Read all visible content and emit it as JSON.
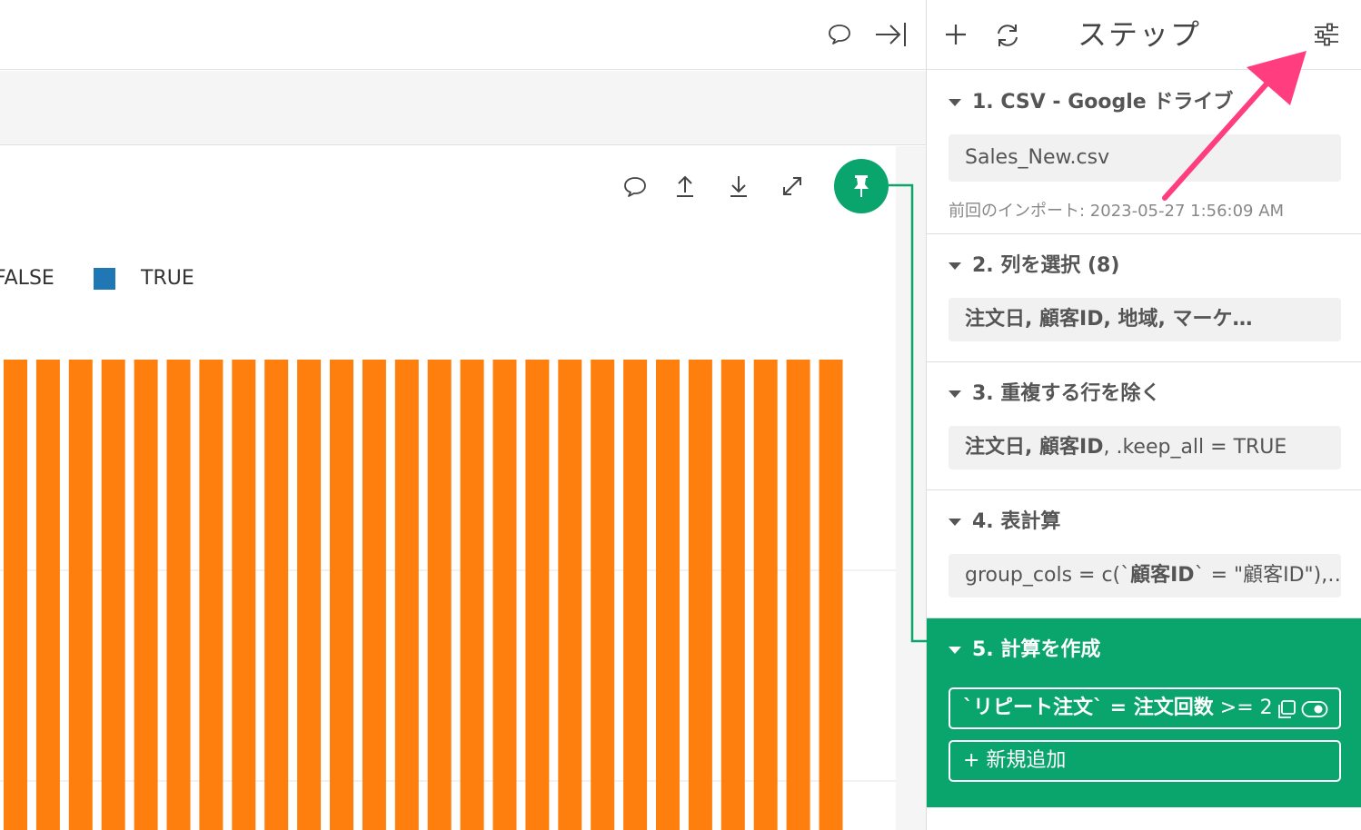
{
  "right_panel": {
    "title": "ステップ",
    "steps": [
      {
        "title": "1. CSV - Google ドライブ",
        "value": "Sales_New.csv",
        "sub": "前回のインポート: 2023-05-27 1:56:09 AM"
      },
      {
        "title": "2. 列を選択 (8)",
        "value": "注文日, 顧客ID, 地域, マーケ…"
      },
      {
        "title": "3. 重複する行を除く",
        "value_bold": "注文日, 顧客ID",
        "value_rest": ", .keep_all = TRUE"
      },
      {
        "title": "4. 表計算",
        "value_pre": "group_cols = c(`",
        "value_bold": "顧客ID",
        "value_post": "` = \"顧客ID\"),…"
      },
      {
        "title": "5. 計算を作成",
        "value_bold": "`リピート注文` = 注文回数",
        "value_rest": " >= 2",
        "add_label": "+ 新規追加"
      }
    ]
  },
  "chart": {
    "legend": [
      {
        "label": "FALSE",
        "color": "#ff7f0e"
      },
      {
        "label": "TRUE",
        "color": "#1f77b4"
      }
    ]
  },
  "chart_data": {
    "type": "bar",
    "series": [
      {
        "name": "FALSE",
        "color": "#ff7f0e"
      },
      {
        "name": "TRUE",
        "color": "#1f77b4"
      }
    ],
    "visible_bar_count": 26
  },
  "colors": {
    "accent_green": "#0aa56d",
    "arrow_pink": "#ff3d7f"
  },
  "icons": [
    "comment-icon",
    "collapse-panel-icon",
    "upload-icon",
    "download-icon",
    "expand-icon",
    "pin-icon",
    "plus-icon",
    "refresh-icon",
    "settings-sliders-icon",
    "copy-icon",
    "toggle-icon"
  ]
}
